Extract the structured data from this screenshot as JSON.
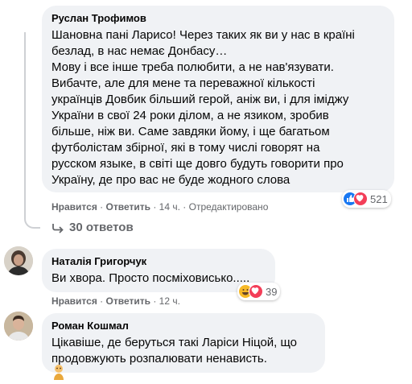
{
  "comments": [
    {
      "author": "Руслан Трофимов",
      "lines": [
        "Шановна пані Ларисо! Через таких як ви у нас в країні",
        "безлад, в нас немає Донбасу…",
        "Мову і все інше треба полюбити, а не нав'язувати.",
        "Вибачте, але для мене та переважної кількості",
        "українців Довбик більший герой, аніж ви, і для іміджу",
        "України в свої 24 роки ділом, а не язиком, зробив",
        "більше, ніж ви. Саме завдяки йому, і ще багатьом",
        "футболістам збірної, які в тому числі говорят на",
        "русском языке, в світі ще довго будуть говорити про",
        "Україну, де про вас не буде жодного слова"
      ],
      "like_label": "Нравится",
      "reply_label": "Ответить",
      "time": "14 ч.",
      "edited": "Отредактировано",
      "reaction_count": "521",
      "replies_label": "30 ответов"
    },
    {
      "author": "Наталія Григорчук",
      "lines": [
        "Ви хвора. Просто посміховисько....."
      ],
      "like_label": "Нравится",
      "reply_label": "Ответить",
      "time": "12 ч.",
      "reaction_count": "39"
    },
    {
      "author": "Роман Кошмал",
      "lines": [
        "Цікавіше, де беруться такі Ларіси Ніцой, що",
        "продовжують розпалювати ненависть."
      ]
    }
  ],
  "separator": "·",
  "colors": {
    "like_blue": "#1877f2",
    "love_red": "#f33e58",
    "bubble": "#f0f2f5"
  }
}
